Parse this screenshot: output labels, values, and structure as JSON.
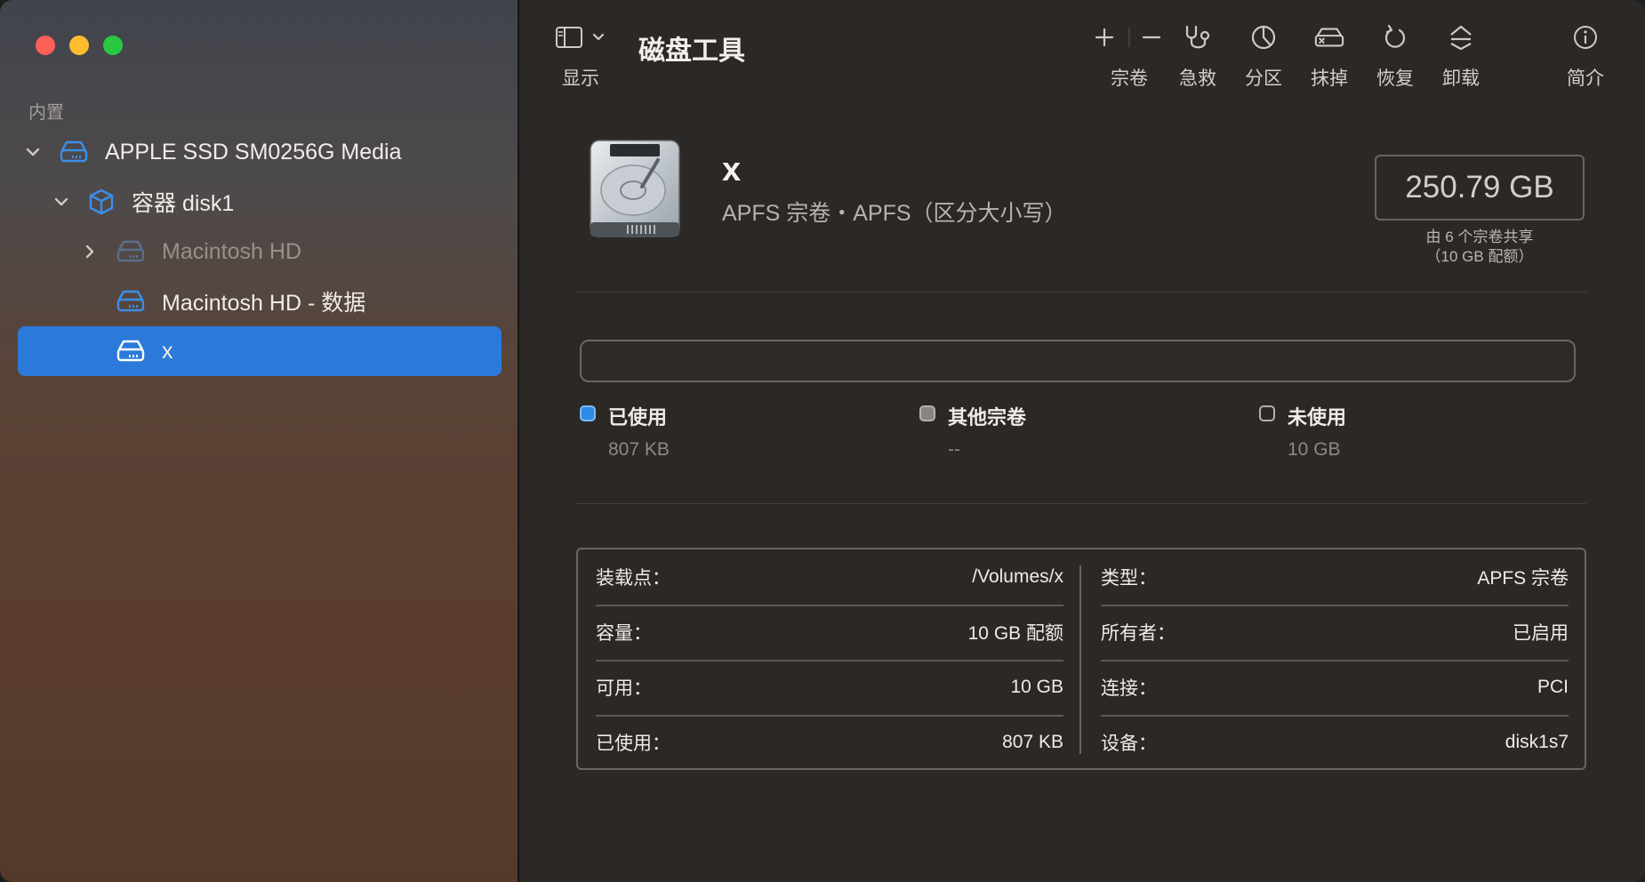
{
  "app": {
    "title": "磁盘工具"
  },
  "toolbar": {
    "view_label": "显示",
    "volume_label": "宗卷",
    "firstaid_label": "急救",
    "partition_label": "分区",
    "erase_label": "抹掉",
    "restore_label": "恢复",
    "unmount_label": "卸载",
    "info_label": "简介"
  },
  "sidebar": {
    "section": "内置",
    "items": [
      {
        "label": "APPLE SSD SM0256G Media",
        "expanded": true
      },
      {
        "label": "容器 disk1",
        "expanded": true
      },
      {
        "label": "Macintosh HD",
        "expanded": false,
        "dimmed": true
      },
      {
        "label": "Macintosh HD - 数据"
      },
      {
        "label": "x",
        "selected": true
      }
    ]
  },
  "volume": {
    "name": "x",
    "subtitle": "APFS 宗卷・APFS（区分大小写）",
    "size": "250.79 GB",
    "size_note_line1": "由 6 个宗卷共享",
    "size_note_line2": "（10 GB 配额）"
  },
  "usage": {
    "used": {
      "label": "已使用",
      "value": "807 KB",
      "color": "#2f8be3"
    },
    "other": {
      "label": "其他宗卷",
      "value": "--",
      "color": "#8a8480"
    },
    "free": {
      "label": "未使用",
      "value": "10 GB",
      "color": "#2b2826"
    }
  },
  "info": {
    "left": [
      {
        "key": "装载点：",
        "value": "/Volumes/x"
      },
      {
        "key": "容量：",
        "value": "10 GB 配额"
      },
      {
        "key": "可用：",
        "value": "10 GB"
      },
      {
        "key": "已使用：",
        "value": "807 KB"
      }
    ],
    "right": [
      {
        "key": "类型：",
        "value": "APFS 宗卷"
      },
      {
        "key": "所有者：",
        "value": "已启用"
      },
      {
        "key": "连接：",
        "value": "PCI"
      },
      {
        "key": "设备：",
        "value": "disk1s7"
      }
    ]
  },
  "colors": {
    "accent": "#2b7ad9",
    "icon_blue": "#3b8fe8"
  }
}
